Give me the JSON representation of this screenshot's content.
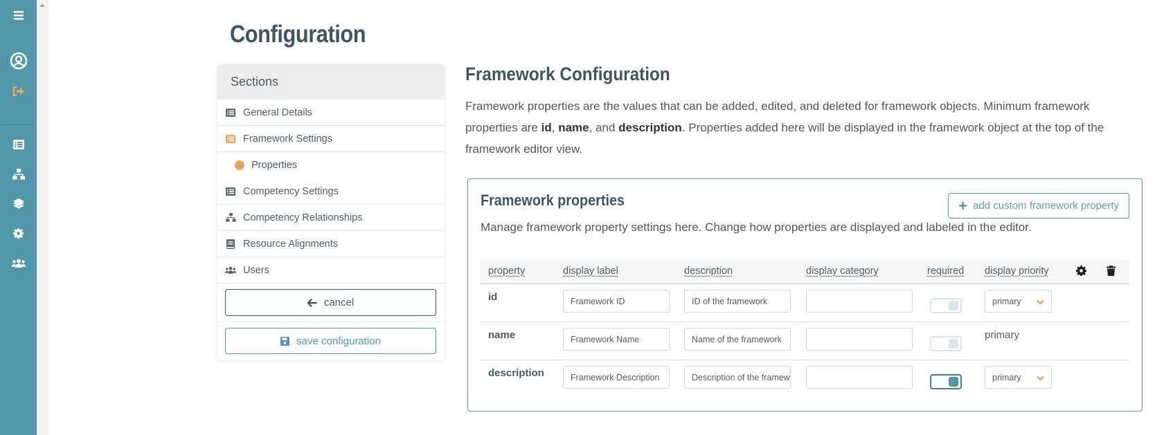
{
  "app": {
    "rail": {
      "items": [
        {
          "icon": "menu-icon"
        },
        {
          "icon": "user-circle-icon"
        },
        {
          "icon": "sign-out-icon",
          "color": "#e8a55b"
        },
        {
          "icon": "list-icon"
        },
        {
          "icon": "sitemap-icon"
        },
        {
          "icon": "layers-icon"
        },
        {
          "icon": "gear-icon"
        },
        {
          "icon": "users-icon"
        }
      ],
      "color": "#5298a8"
    }
  },
  "page": {
    "title": "Configuration"
  },
  "sections": {
    "header": "Sections",
    "items": [
      {
        "label": "General Details",
        "icon": "list-alt-icon"
      },
      {
        "label": "Framework Settings",
        "icon": "list-alt-icon",
        "active": true
      },
      {
        "label": "Properties",
        "icon": "dot-icon",
        "sub": true
      },
      {
        "label": "Competency Settings",
        "icon": "list-alt-icon"
      },
      {
        "label": "Competency Relationships",
        "icon": "sitemap-icon"
      },
      {
        "label": "Resource Alignments",
        "icon": "book-icon"
      },
      {
        "label": "Users",
        "icon": "users-icon"
      }
    ],
    "cancel_label": "cancel",
    "save_label": "save configuration"
  },
  "framework_config": {
    "title": "Framework Configuration",
    "desc_part1": "Framework properties are the values that can be added, edited, and deleted for framework objects. Minimum framework properties are ",
    "desc_bold1": "id",
    "desc_sep1": ", ",
    "desc_bold2": "name",
    "desc_sep2": ", and ",
    "desc_bold3": "description",
    "desc_part2": ". Properties added here will be displayed in the framework object at the top of the framework editor view."
  },
  "framework_properties": {
    "title": "Framework properties",
    "add_label": "add custom framework property",
    "description": "Manage framework property settings here. Change how properties are displayed and labeled in the editor.",
    "columns": [
      "property",
      "display label",
      "description",
      "display category",
      "required",
      "display priority"
    ],
    "rows": [
      {
        "property": "id",
        "display_label": "Framework ID",
        "description": "ID of the framework",
        "display_category": "",
        "required": false,
        "display_priority": "primary",
        "priority_editable": true
      },
      {
        "property": "name",
        "display_label": "Framework Name",
        "description": "Name of the framework",
        "display_category": "",
        "required": false,
        "display_priority": "primary",
        "priority_editable": false
      },
      {
        "property": "description",
        "display_label": "Framework Description",
        "description": "Description of the framework",
        "display_category": "",
        "required": true,
        "display_priority": "primary",
        "priority_editable": true
      }
    ]
  },
  "colors": {
    "accent": "#5298a8",
    "highlight": "#e8a55b",
    "heading": "#3f5561"
  }
}
